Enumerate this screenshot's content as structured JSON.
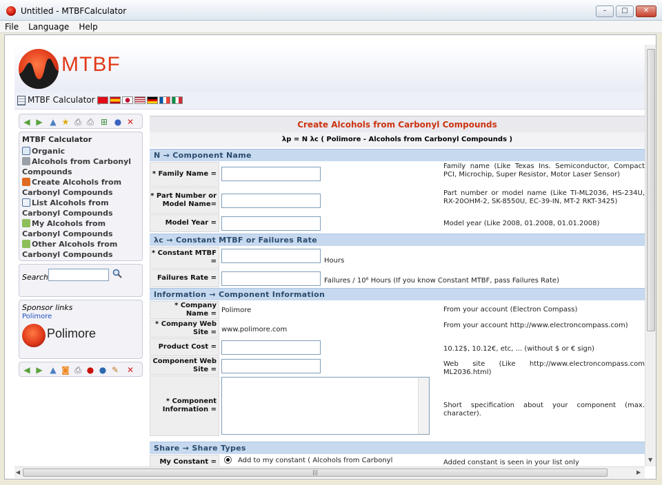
{
  "window": {
    "title": "Untitled - MTBFCalculator",
    "minimize": "–",
    "maximize": "□",
    "close": "✕"
  },
  "menu": [
    "File",
    "Language",
    "Help"
  ],
  "header": {
    "logo_text": "MTBF",
    "subtitle": "MTBF Calculator",
    "separator": "|"
  },
  "sidebar": {
    "tree_title": "MTBF Calculator",
    "items": [
      {
        "label": "Organic"
      },
      {
        "label": "Alcohols from Carbonyl Compounds"
      },
      {
        "label": "Create Alcohols from Carbonyl Compounds"
      },
      {
        "label": "List Alcohols from Carbonyl Compounds"
      },
      {
        "label": "My Alcohols from Carbonyl Compounds"
      },
      {
        "label": "Other Alcohols from Carbonyl Compounds"
      }
    ],
    "search_label": "Search",
    "sponsor_title": "Sponsor links",
    "sponsor_link": "Polimore",
    "sponsor_logo_text": "Polimore"
  },
  "form": {
    "title": "Create Alcohols from Carbonyl Compounds",
    "formula": "λp = N λc ( Polimore - Alcohols from Carbonyl Compounds )",
    "sections": {
      "component_name": "N →  Component Name",
      "constant_mtbf": "λc →  Constant MTBF or Failures Rate",
      "information": "Information →  Component Information",
      "share": "Share →  Share Types"
    },
    "fields": {
      "family_name": {
        "label": "* Family Name =",
        "hint": "Family name (Like Texas Ins. Semiconductor, Compact PCI, Microchip, Super Resistor, Motor Laser Sensor)"
      },
      "part_number": {
        "label": "* Part Number or Model Name=",
        "hint": "Part number or model name (Like TI-ML2036, HS-234U, RX-20OHM-2, SK-8550U, EC-39-IN, MT-2 RKT-3425)"
      },
      "model_year": {
        "label": "Model Year =",
        "hint": "Model year (Like 2008, 01.2008, 01.01.2008)"
      },
      "constant_mtbf": {
        "label": "* Constant MTBF =",
        "unit": "Hours"
      },
      "failures_rate": {
        "label": "Failures Rate =",
        "unit": "Failures / 10⁶ Hours (If you know Constant MTBF, pass Failures Rate)"
      },
      "company_name": {
        "label": "* Company Name =",
        "value": "Polimore",
        "hint": "From your account (Electron Compass)"
      },
      "company_web": {
        "label": "* Company Web Site =",
        "value": "www.polimore.com",
        "hint": "From your account http://www.electroncompass.com)"
      },
      "product_cost": {
        "label": "Product Cost =",
        "hint": "10.12$, 10.12€, etc, ... (without $ or € sign)"
      },
      "component_web": {
        "label": "Component Web Site =",
        "hint": "Web site (Like http://www.electroncompass.com ML2036.html)"
      },
      "component_info": {
        "label": "* Component Information =",
        "hint": "Short specification about your component (max. character)."
      },
      "my_constant": {
        "label": "My Constant =",
        "option": "Add to my constant ( Alcohols from Carbonyl",
        "hint": "Added constant is seen in your list only"
      }
    }
  },
  "colors": {
    "accent": "#cc3311",
    "section_bg": "#c6d9ef",
    "logo": "#e1391a"
  }
}
